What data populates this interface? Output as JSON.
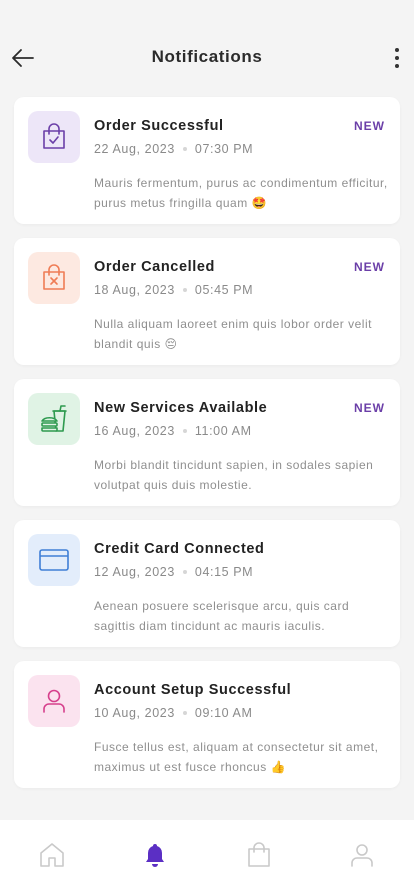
{
  "header": {
    "title": "Notifications"
  },
  "notifications": [
    {
      "title": "Order Successful",
      "badge": "NEW",
      "date": "22 Aug, 2023",
      "time": "07:30 PM",
      "body": "Mauris fermentum, purus ac condimentum efficitur, purus metus fringilla quam 🤩",
      "icon": "shopping-bag-check-icon",
      "icon_color": "#6b3fa8",
      "icon_bg": "#ede6f8"
    },
    {
      "title": "Order Cancelled",
      "badge": "NEW",
      "date": "18 Aug, 2023",
      "time": "05:45 PM",
      "body": "Nulla aliquam laoreet enim quis lobor order velit blandit quis 😔",
      "icon": "shopping-bag-x-icon",
      "icon_color": "#ef7c55",
      "icon_bg": "#fde9e1"
    },
    {
      "title": "New Services Available",
      "badge": "NEW",
      "date": "16 Aug, 2023",
      "time": "11:00 AM",
      "body": "Morbi blandit tincidunt sapien, in sodales sapien volutpat quis duis molestie.",
      "icon": "food-drink-icon",
      "icon_color": "#2e9a4f",
      "icon_bg": "#e0f3e5"
    },
    {
      "title": "Credit Card Connected",
      "badge": "",
      "date": "12 Aug, 2023",
      "time": "04:15 PM",
      "body": "Aenean posuere scelerisque arcu, quis card sagittis diam tincidunt ac mauris iaculis.",
      "icon": "credit-card-icon",
      "icon_color": "#3f7fd6",
      "icon_bg": "#e3edfb"
    },
    {
      "title": "Account Setup Successful",
      "badge": "",
      "date": "10 Aug, 2023",
      "time": "09:10 AM",
      "body": "Fusce tellus est, aliquam at consectetur sit amet, maximus ut est fusce rhoncus 👍",
      "icon": "user-icon",
      "icon_color": "#d63f8c",
      "icon_bg": "#fbe3ef"
    }
  ],
  "bottom_nav": [
    {
      "icon": "home-icon",
      "active": false
    },
    {
      "icon": "bell-icon",
      "active": true
    },
    {
      "icon": "shopping-bag-icon",
      "active": false
    },
    {
      "icon": "profile-icon",
      "active": false
    }
  ],
  "colors": {
    "accent": "#5b2fc4",
    "inactive_icon": "#c9c9c9",
    "badge": "#6b3fa8"
  }
}
